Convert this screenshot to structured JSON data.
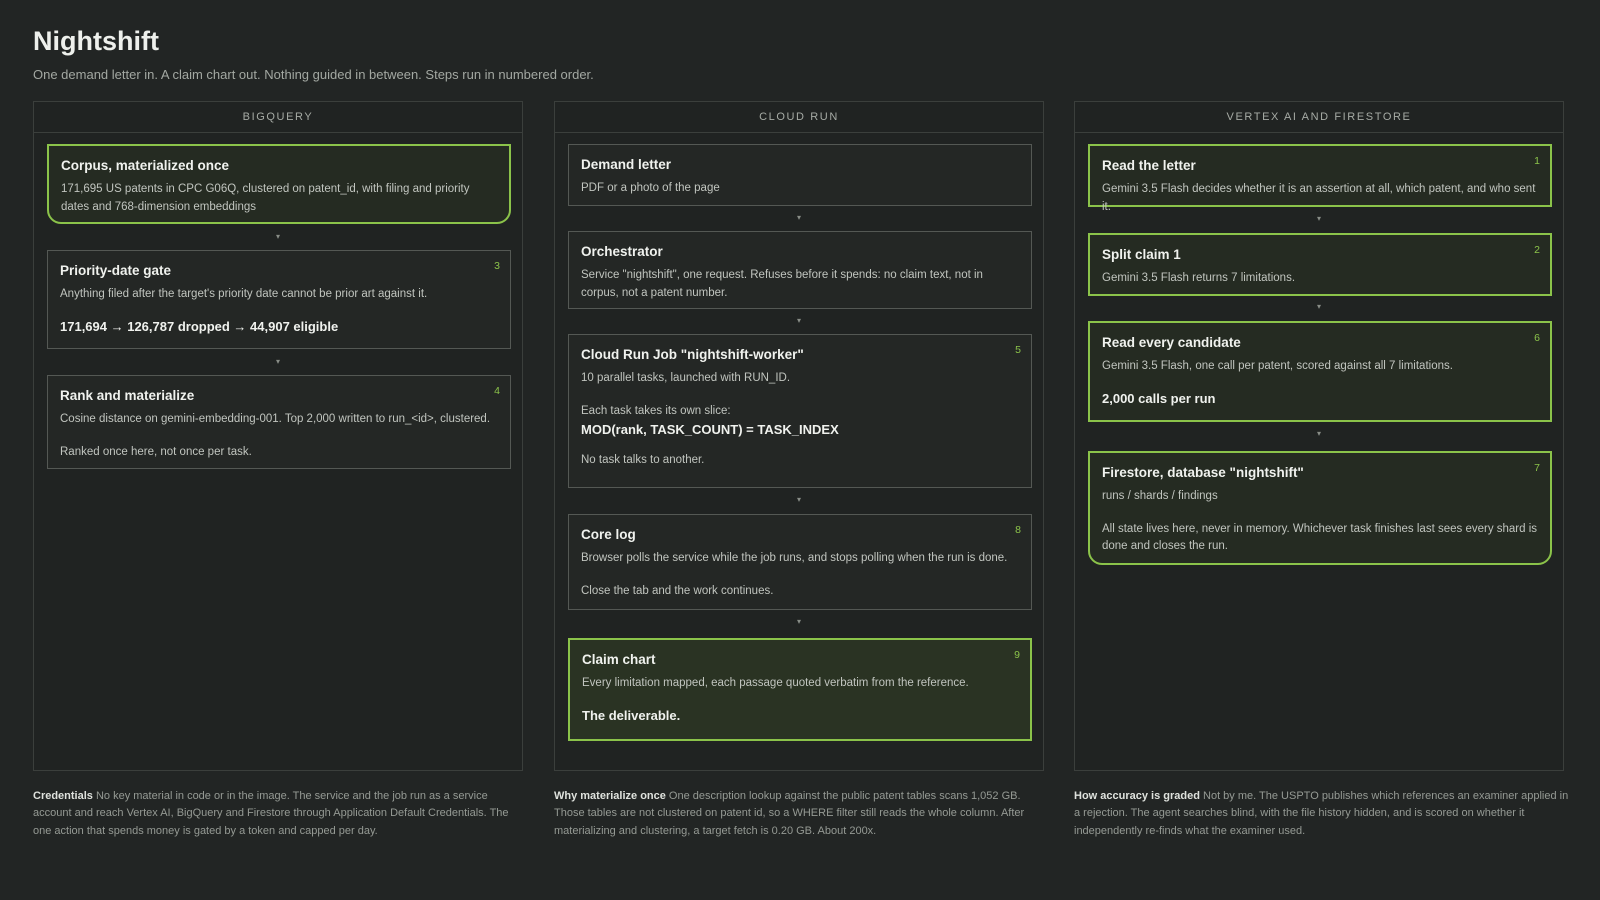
{
  "header": {
    "title": "Nightshift",
    "subtitle": "One demand letter in. A claim chart out. Nothing guided in between. Steps run in numbered order."
  },
  "columns": [
    {
      "label": "BIGQUERY",
      "cards": [
        {
          "title": "Corpus, materialized once",
          "text": "171,695 US patents in CPC G06Q, clustered on patent_id, with filing and priority dates and 768-dimension embeddings"
        },
        {
          "step": "3",
          "title": "Priority-date gate",
          "text": "Anything filed after the target's priority date cannot be prior art against it.",
          "strong": "171,694 → 126,787 dropped → 44,907 eligible"
        },
        {
          "step": "4",
          "title": "Rank and materialize",
          "text": "Cosine distance on gemini-embedding-001. Top 2,000 written to run_<id>, clustered.",
          "text2": "Ranked once here, not once per task."
        }
      ]
    },
    {
      "label": "CLOUD RUN",
      "cards": [
        {
          "title": "Demand letter",
          "text": "PDF or a photo of the page"
        },
        {
          "title": "Orchestrator",
          "text": "Service \"nightshift\", one request. Refuses before it spends: no claim text, not in corpus, not a patent number."
        },
        {
          "step": "5",
          "title": "Cloud Run Job \"nightshift-worker\"",
          "text": "10 parallel tasks, launched with RUN_ID.",
          "text2": "Each task takes its own slice:",
          "strong": "MOD(rank, TASK_COUNT) = TASK_INDEX",
          "text3": "No task talks to another."
        },
        {
          "step": "8",
          "title": "Core log",
          "text": "Browser polls the service while the job runs, and stops polling when the run is done.",
          "text2": "Close the tab and the work continues."
        },
        {
          "step": "9",
          "title": "Claim chart",
          "text": "Every limitation mapped, each passage quoted verbatim from the reference.",
          "strong": "The deliverable."
        }
      ]
    },
    {
      "label": "VERTEX AI AND FIRESTORE",
      "cards": [
        {
          "step": "1",
          "title": "Read the letter",
          "text": "Gemini 3.5 Flash decides whether it is an assertion at all, which patent, and who sent it."
        },
        {
          "step": "2",
          "title": "Split claim 1",
          "text": "Gemini 3.5 Flash returns 7 limitations."
        },
        {
          "step": "6",
          "title": "Read every candidate",
          "text": "Gemini 3.5 Flash, one call per patent, scored against all 7 limitations.",
          "strong": "2,000 calls per run"
        },
        {
          "step": "7",
          "title": "Firestore, database \"nightshift\"",
          "text": "runs / shards / findings",
          "text2": "All state lives here, never in memory. Whichever task finishes last sees every shard is done and closes the run."
        }
      ]
    }
  ],
  "arrow_glyph": "▾",
  "footnotes": [
    {
      "lead": "Credentials",
      "text": " No key material in code or in the image. The service and the job run as a service account and reach Vertex AI, BigQuery and Firestore through Application Default Credentials. The one action that spends money is gated by a token and capped per day."
    },
    {
      "lead": "Why materialize once",
      "text": " One description lookup against the public patent tables scans 1,052 GB. Those tables are not clustered on patent id, so a WHERE filter still reads the whole column. After materializing and clustering, a target fetch is 0.20 GB. About 200x."
    },
    {
      "lead": "How accuracy is graded",
      "text": " Not by me. The USPTO publishes which references an examiner applied in a rejection. The agent searches blind, with the file history hidden, and is scored on whether it independently re-finds what the examiner used."
    }
  ],
  "colors": {
    "background": "#222524",
    "accent": "#8bc34a",
    "card_border": "#545854",
    "final_fill": "#2a3323"
  }
}
